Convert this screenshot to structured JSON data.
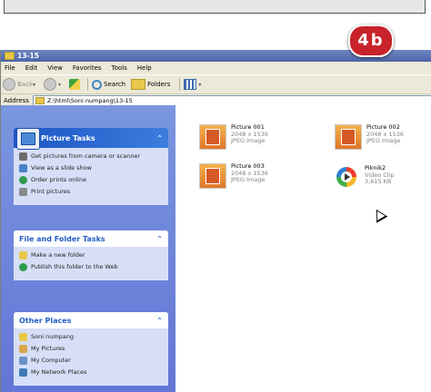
{
  "badge": "4b",
  "window": {
    "title": "13-15"
  },
  "menu": [
    "File",
    "Edit",
    "View",
    "Favorites",
    "Tools",
    "Help"
  ],
  "toolbar": {
    "back": "Back",
    "search": "Search",
    "folders": "Folders"
  },
  "address": {
    "label": "Address",
    "path": "Z:\\html\\Soni numpang\\13-15"
  },
  "picture_tasks": {
    "title": "Picture Tasks",
    "items": [
      {
        "label": "Get pictures from camera or scanner",
        "icon": "camera-icon"
      },
      {
        "label": "View as a slide show",
        "icon": "slideshow-icon"
      },
      {
        "label": "Order prints online",
        "icon": "globe-icon"
      },
      {
        "label": "Print pictures",
        "icon": "printer-icon"
      }
    ]
  },
  "file_tasks": {
    "title": "File and Folder Tasks",
    "items": [
      {
        "label": "Make a new folder",
        "icon": "new-folder-icon"
      },
      {
        "label": "Publish this folder to the Web",
        "icon": "globe-icon"
      }
    ]
  },
  "other_places": {
    "title": "Other Places",
    "items": [
      {
        "label": "Soni numpang",
        "icon": "folder-icon"
      },
      {
        "label": "My Pictures",
        "icon": "pictures-icon"
      },
      {
        "label": "My Computer",
        "icon": "computer-icon"
      },
      {
        "label": "My Network Places",
        "icon": "network-icon"
      }
    ]
  },
  "files": [
    {
      "name": "Picture 001",
      "line2": "2048 x 1536",
      "line3": "JPEG Image",
      "kind": "image"
    },
    {
      "name": "Picture 002",
      "line2": "2048 x 1536",
      "line3": "JPEG Image",
      "kind": "image"
    },
    {
      "name": "Picture 003",
      "line2": "2048 x 1536",
      "line3": "JPEG Image",
      "kind": "image"
    },
    {
      "name": "Piknik2",
      "line2": "Video Clip",
      "line3": "3,615 KB",
      "kind": "video"
    }
  ],
  "colors": {
    "taskpane": "#6f86d9",
    "panel_body": "#d6dff7",
    "panel_title": "#215dc6",
    "badge": "#c8232a"
  }
}
